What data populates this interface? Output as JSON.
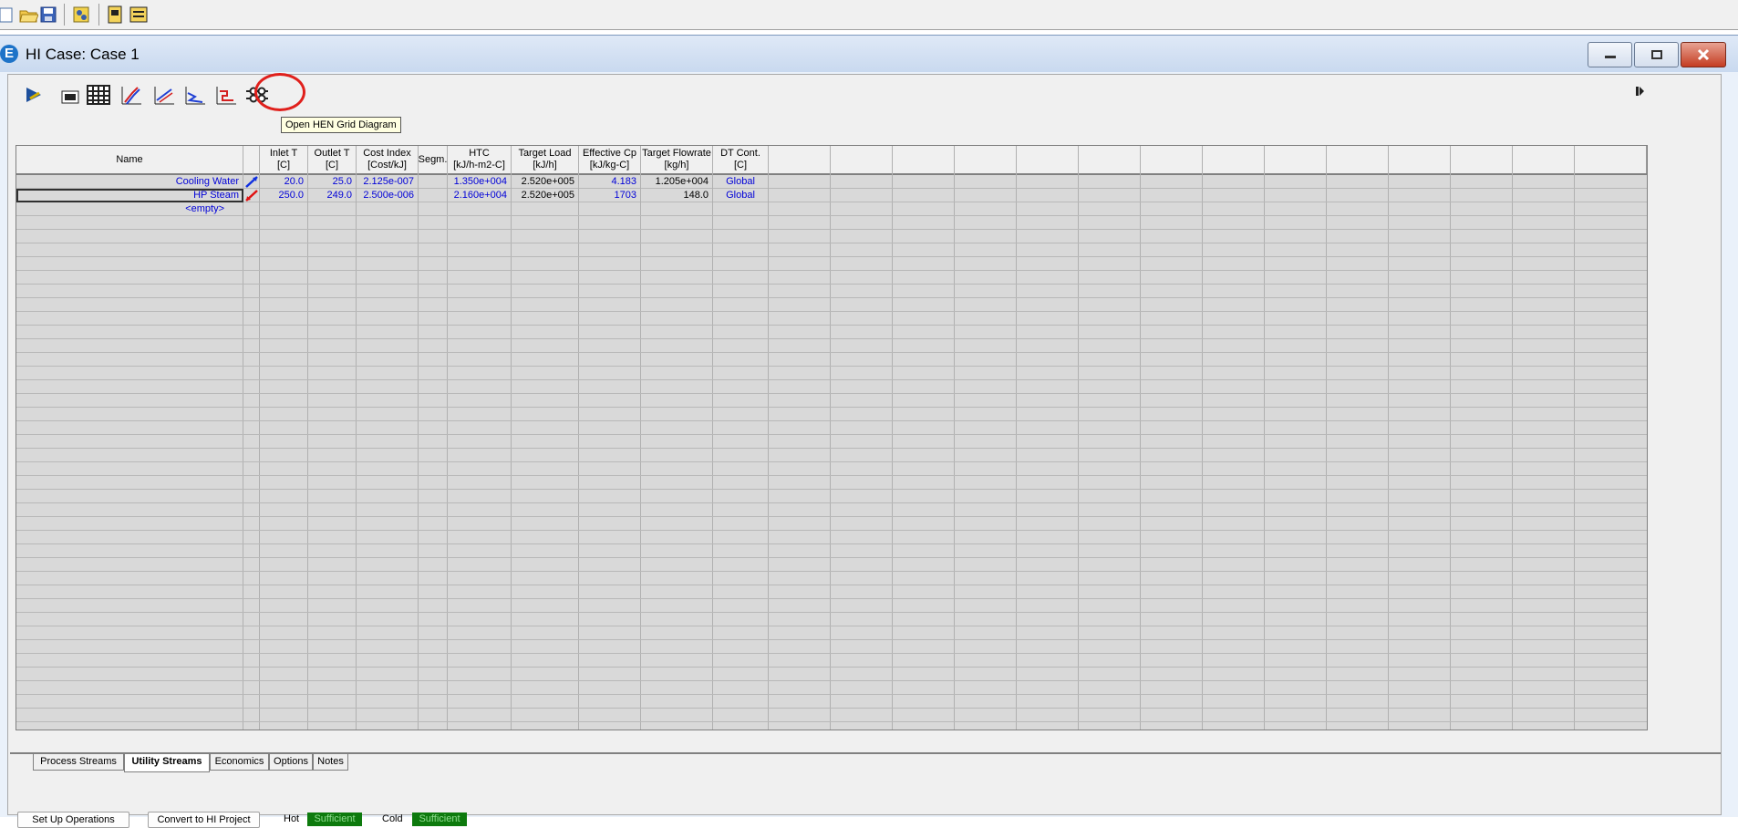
{
  "app_toolbar": {
    "icons": [
      "new-icon",
      "open-icon",
      "save-icon",
      "simulation-icon",
      "workbook-icon",
      "report-icon"
    ]
  },
  "window": {
    "title": "HI Case: Case 1",
    "icon_letter": "E"
  },
  "toolbar": {
    "tooltip": "Open HEN Grid Diagram",
    "icons": [
      "flowsheet-icon",
      "targets-icon",
      "table-icon",
      "composite-curve-icon",
      "grand-composite-icon",
      "balanced-curve-icon",
      "utility-curve-icon",
      "hen-grid-icon"
    ]
  },
  "table": {
    "columns": [
      {
        "line1": "Name",
        "line2": ""
      },
      {
        "line1": "",
        "line2": ""
      },
      {
        "line1": "Inlet T",
        "line2": "[C]"
      },
      {
        "line1": "Outlet T",
        "line2": "[C]"
      },
      {
        "line1": "Cost Index",
        "line2": "[Cost/kJ]"
      },
      {
        "line1": "Segm.",
        "line2": ""
      },
      {
        "line1": "HTC",
        "line2": "[kJ/h-m2-C]"
      },
      {
        "line1": "Target Load",
        "line2": "[kJ/h]"
      },
      {
        "line1": "Effective Cp",
        "line2": "[kJ/kg-C]"
      },
      {
        "line1": "Target Flowrate",
        "line2": "[kg/h]"
      },
      {
        "line1": "DT Cont.",
        "line2": "[C]"
      }
    ],
    "rows": [
      {
        "name": "Cooling Water",
        "type": "cold",
        "inlet": "20.0",
        "outlet": "25.0",
        "cost": "2.125e-007",
        "segm": "",
        "htc": "1.350e+004",
        "load": "2.520e+005",
        "cp": "4.183",
        "flow": "1.205e+004",
        "dt": "Global"
      },
      {
        "name": "HP Steam",
        "type": "hot",
        "inlet": "250.0",
        "outlet": "249.0",
        "cost": "2.500e-006",
        "segm": "",
        "htc": "2.160e+004",
        "load": "2.520e+005",
        "cp": "1703",
        "flow": "148.0",
        "dt": "Global"
      },
      {
        "name": "<empty>"
      }
    ]
  },
  "tabs": [
    "Process Streams",
    "Utility Streams",
    "Economics",
    "Options",
    "Notes"
  ],
  "active_tab": "Utility Streams",
  "footer": {
    "setup_button": "Set Up Operations",
    "convert_button": "Convert to HI Project",
    "hot_label": "Hot",
    "hot_status": "Sufficient",
    "cold_label": "Cold",
    "cold_status": "Sufficient"
  }
}
